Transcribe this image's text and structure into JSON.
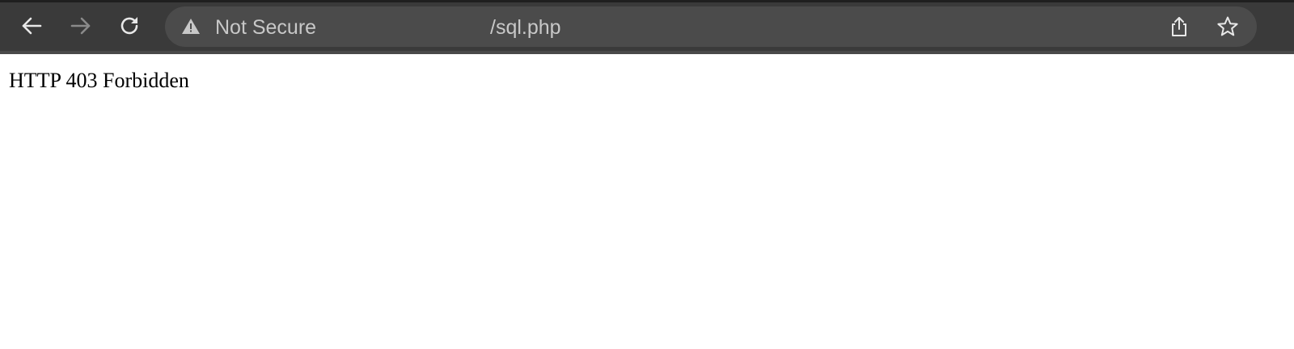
{
  "browser": {
    "toolbar": {
      "back_icon": "arrow-left-icon",
      "forward_icon": "arrow-right-icon",
      "reload_icon": "reload-icon"
    },
    "omnibox": {
      "security_icon": "warning-triangle-icon",
      "security_label": "Not Secure",
      "url_visible_suffix": "/sql.php",
      "share_icon": "share-icon",
      "bookmark_icon": "star-icon"
    },
    "colors": {
      "toolbar_bg": "#3a3a3a",
      "omnibox_bg": "#4b4b4b",
      "omnibox_text": "#c8c8c8",
      "icon_color": "#e8e8e8"
    }
  },
  "page": {
    "body_text": "HTTP 403 Forbidden"
  }
}
